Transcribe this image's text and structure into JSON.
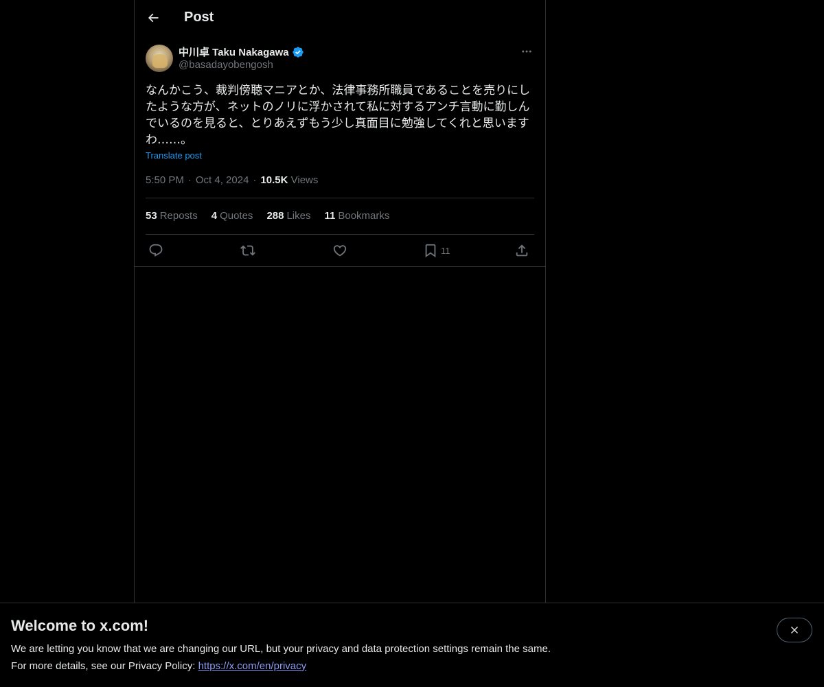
{
  "header": {
    "title": "Post"
  },
  "post": {
    "display_name": "中川卓 Taku Nakagawa",
    "handle": "@basadayobengosh",
    "text": "なんかこう、裁判傍聴マニアとか、法律事務所職員であることを売りにしたような方が、ネットのノリに浮かされて私に対するアンチ言動に勤しんでいるのを見ると、とりあえずもう少し真面目に勉強してくれと思いますわ……。",
    "translate_label": "Translate post",
    "time": "5:50 PM",
    "date": "Oct 4, 2024",
    "views_count": "10.5K",
    "views_label": "Views",
    "separator": "·"
  },
  "stats": {
    "reposts_count": "53",
    "reposts_label": "Reposts",
    "quotes_count": "4",
    "quotes_label": "Quotes",
    "likes_count": "288",
    "likes_label": "Likes",
    "bookmarks_count": "11",
    "bookmarks_label": "Bookmarks"
  },
  "actions": {
    "bookmark_count": "11"
  },
  "banner": {
    "title": "Welcome to x.com!",
    "line1": "We are letting you know that we are changing our URL, but your privacy and data protection settings remain the same.",
    "line2_prefix": "For more details, see our Privacy Policy: ",
    "link_text": "https://x.com/en/privacy"
  },
  "colors": {
    "background": "#000000",
    "text": "#e7e9ea",
    "muted": "#71767b",
    "accent": "#1d9bf0",
    "border": "#2f3336"
  },
  "icons": [
    "back-arrow-icon",
    "verified-badge-icon",
    "more-icon",
    "reply-icon",
    "repost-icon",
    "like-icon",
    "bookmark-icon",
    "share-icon",
    "close-icon"
  ]
}
